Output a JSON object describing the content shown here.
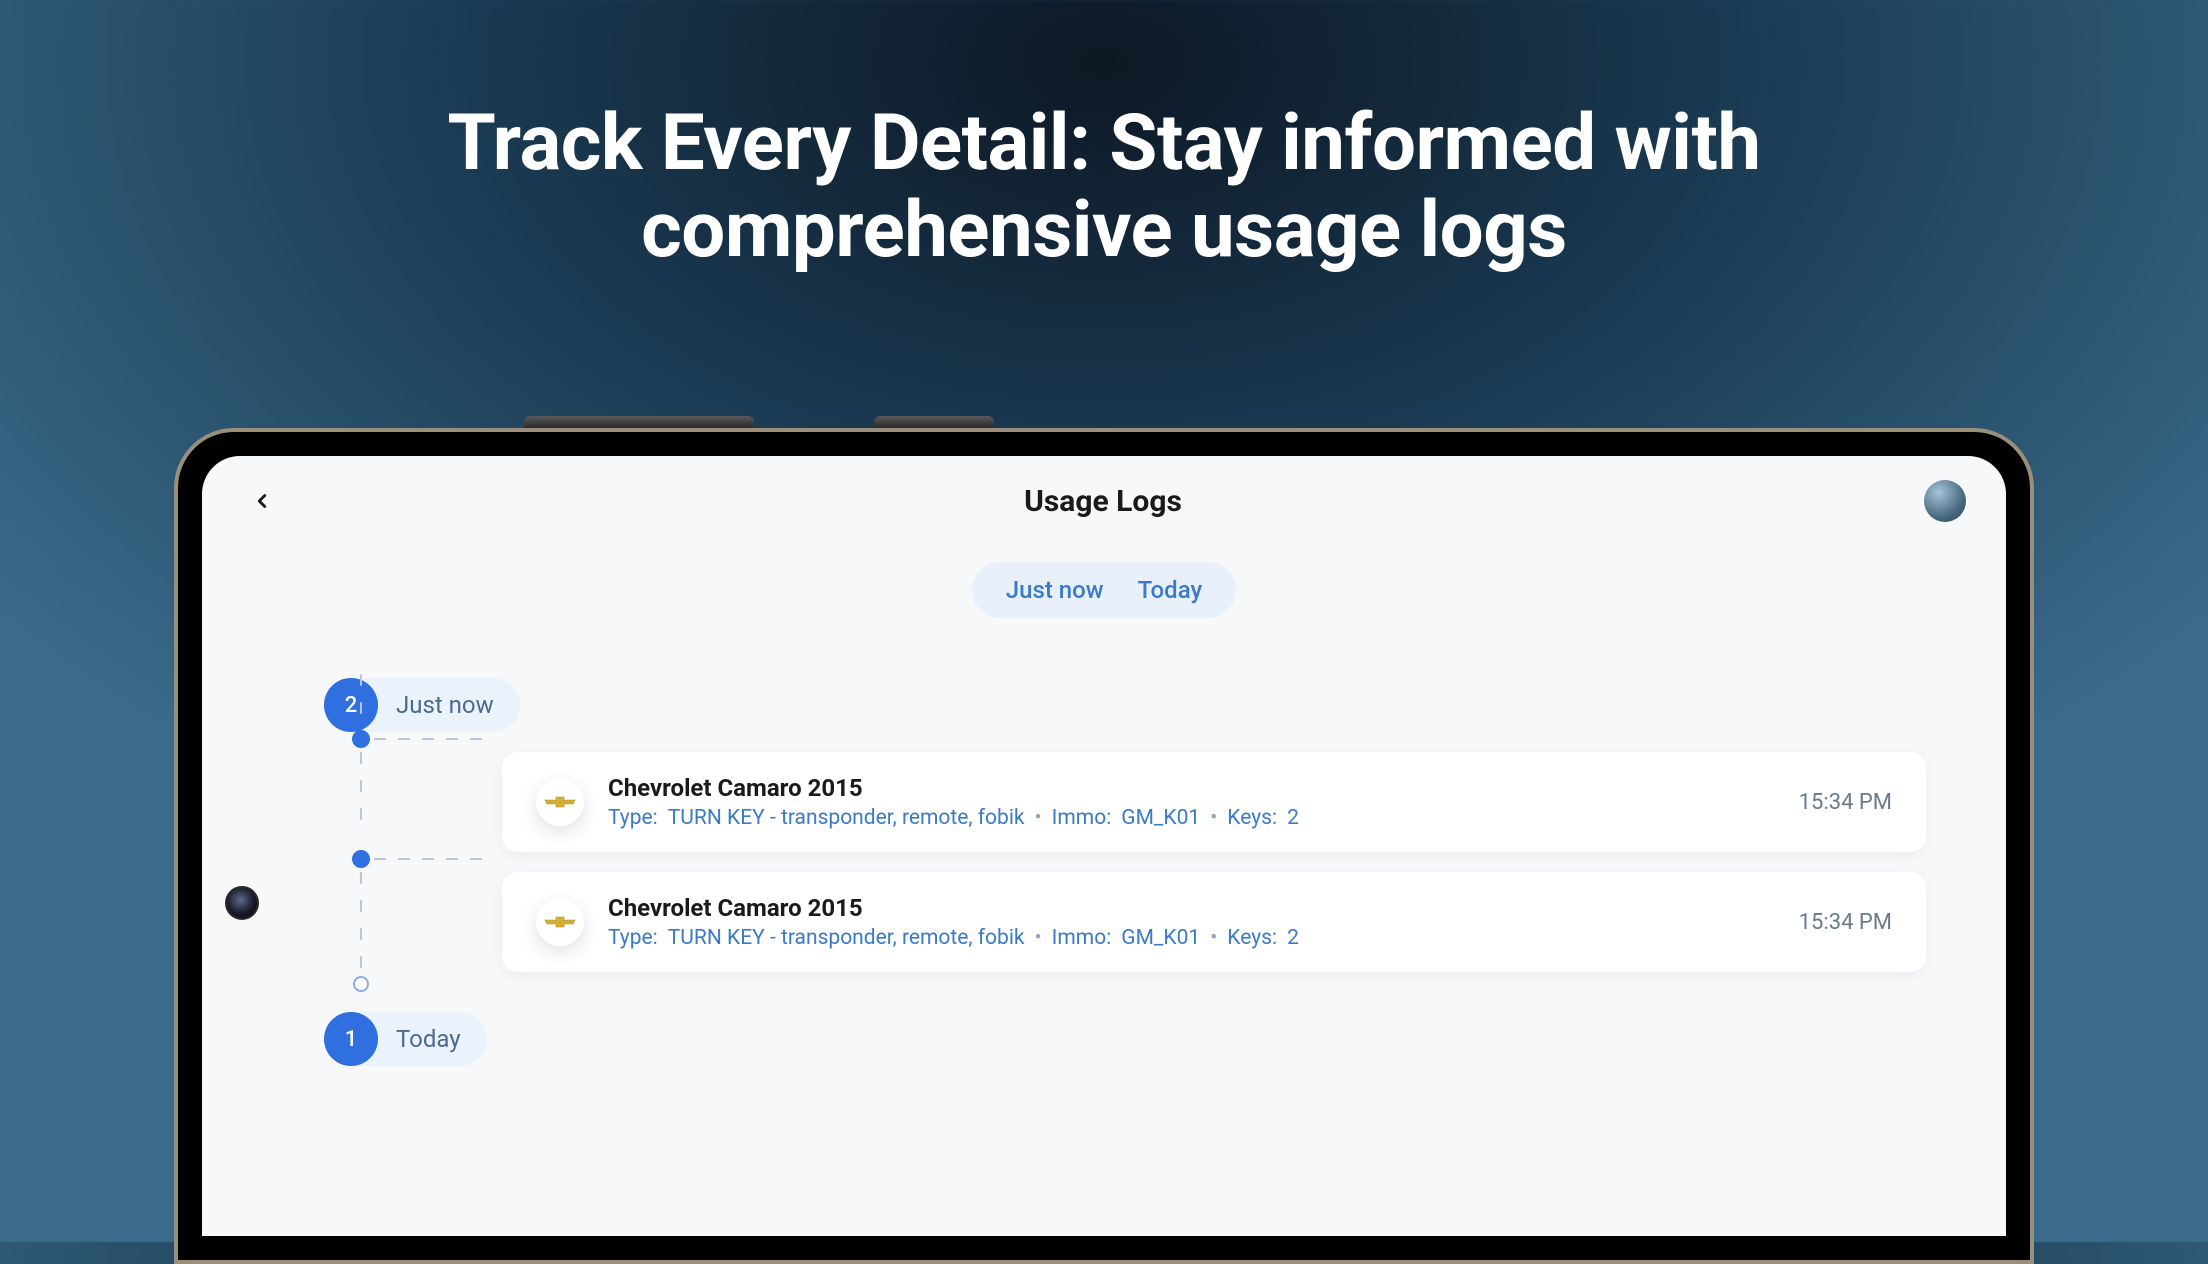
{
  "hero": {
    "title": "Track Every Detail: Stay informed with comprehensive usage logs"
  },
  "header": {
    "title": "Usage Logs"
  },
  "filters": {
    "items": [
      "Just now",
      "Today"
    ]
  },
  "sections": [
    {
      "count": "2",
      "label": "Just now",
      "entries": [
        {
          "title": "Chevrolet Camaro 2015",
          "type_label": "Type:",
          "type_value": "TURN KEY - transponder, remote, fobik",
          "immo_label": "Immo:",
          "immo_value": "GM_K01",
          "keys_label": "Keys:",
          "keys_value": "2",
          "time": "15:34 PM",
          "brand_icon": "chevrolet-logo"
        },
        {
          "title": "Chevrolet Camaro 2015",
          "type_label": "Type:",
          "type_value": "TURN KEY - transponder, remote, fobik",
          "immo_label": "Immo:",
          "immo_value": "GM_K01",
          "keys_label": "Keys:",
          "keys_value": "2",
          "time": "15:34 PM",
          "brand_icon": "chevrolet-logo"
        }
      ]
    },
    {
      "count": "1",
      "label": "Today",
      "entries": []
    }
  ]
}
